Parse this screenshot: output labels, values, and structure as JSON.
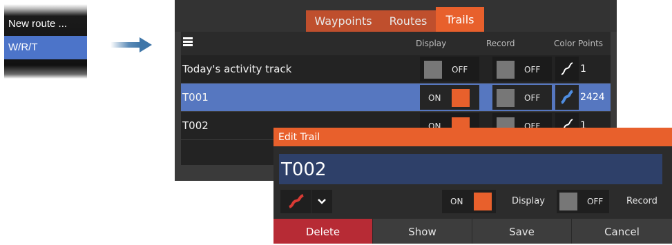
{
  "context_menu": {
    "items": [
      {
        "label": "New route ..."
      },
      {
        "label": "W/R/T"
      }
    ]
  },
  "tabs": [
    {
      "label": "Waypoints"
    },
    {
      "label": "Routes"
    },
    {
      "label": "Trails",
      "active": true
    }
  ],
  "table": {
    "headers": {
      "display": "Display",
      "record": "Record",
      "color": "Color",
      "points": "Points"
    },
    "rows": [
      {
        "name": "Today's activity track",
        "display": "OFF",
        "record": "OFF",
        "color_icon": "trail-white-icon",
        "points": "1"
      },
      {
        "name": "T001",
        "display": "ON",
        "record": "OFF",
        "color_icon": "trail-blue-icon",
        "points": "2424"
      },
      {
        "name": "T002",
        "display": "ON",
        "record": "OFF",
        "color_icon": "trail-white-icon",
        "points": "1"
      }
    ]
  },
  "edit_dialog": {
    "title": "Edit Trail",
    "name_value": "T002",
    "display_toggle": "ON",
    "display_label": "Display",
    "record_toggle": "OFF",
    "record_label": "Record",
    "color": "#d93a34",
    "buttons": {
      "delete": "Delete",
      "show": "Show",
      "save": "Save",
      "cancel": "Cancel"
    }
  },
  "colors": {
    "accent": "#e8602c",
    "selection": "#5677c0",
    "delete": "#b72b35"
  }
}
